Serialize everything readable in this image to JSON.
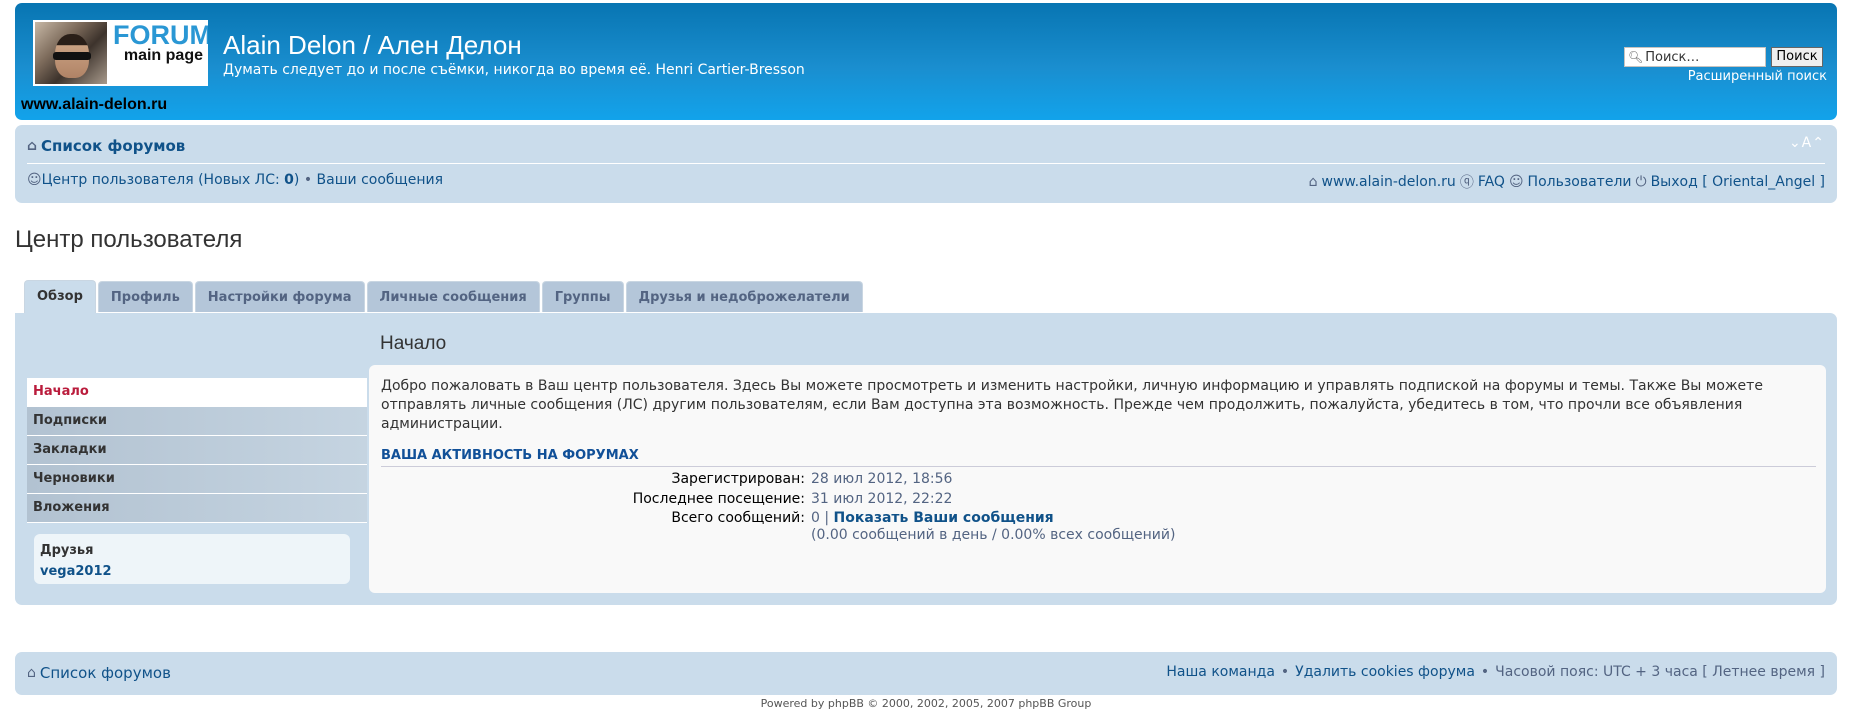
{
  "header": {
    "logo": {
      "line1": "FORUM",
      "line2": "main page"
    },
    "title": "Alain Delon / Ален Делон",
    "description": "Думать следует до и после съёмки, никогда во время её. Henri Cartier-Bresson",
    "site_url": "www.alain-delon.ru",
    "search": {
      "placeholder": "Поиск…",
      "button": "Поиск",
      "advanced": "Расширенный поиск"
    }
  },
  "navbar": {
    "forum_index": "Список форумов",
    "font_resize": "⌄A⌃",
    "ucp": {
      "label": "Центр пользователя (Новых ЛС: ",
      "count": "0",
      "close": ")",
      "sep": " • ",
      "your_posts": "Ваши сообщения"
    },
    "right": {
      "site": "www.alain-delon.ru",
      "faq": "FAQ",
      "members": "Пользователи",
      "logout": "Выход [ Oriental_Angel ]"
    }
  },
  "page_title": "Центр пользователя",
  "tabs": [
    {
      "label": "Обзор",
      "active": true
    },
    {
      "label": "Профиль"
    },
    {
      "label": "Настройки форума"
    },
    {
      "label": "Личные сообщения"
    },
    {
      "label": "Группы"
    },
    {
      "label": "Друзья и недоброжелатели"
    }
  ],
  "side_menu": [
    "Начало",
    "Подписки",
    "Закладки",
    "Черновики",
    "Вложения"
  ],
  "friends": {
    "title": "Друзья",
    "name": "vega2012"
  },
  "content": {
    "title": "Начало",
    "welcome": "Добро пожаловать в Ваш центр пользователя. Здесь Вы можете просмотреть и изменить настройки, личную информацию и управлять подпиской на форумы и темы. Также Вы можете отправлять личные сообщения (ЛС) другим пользователям, если Вам доступна эта возможность. Прежде чем продолжить, пожалуйста, убедитесь в том, что прочли все объявления администрации.",
    "activity_title": "ВАША АКТИВНОСТЬ НА ФОРУМАХ",
    "registered": {
      "label": "Зарегистрирован:",
      "value": "28 июл 2012, 18:56"
    },
    "last_visit": {
      "label": "Последнее посещение:",
      "value": "31 июл 2012, 22:22"
    },
    "total_posts": {
      "label": "Всего сообщений:",
      "value": "0 | ",
      "link": "Показать Ваши сообщения",
      "stats": "(0.00 сообщений в день / 0.00% всех сообщений)"
    }
  },
  "footer": {
    "forum_index": "Список форумов",
    "team": "Наша команда",
    "sep1": "•",
    "delete_cookies": "Удалить cookies форума",
    "sep2": "•",
    "timezone": "Часовой пояс: UTC + 3 часа [ Летнее время ]",
    "copyright": "Powered by phpBB © 2000, 2002, 2005, 2007 phpBB Group"
  },
  "colors": {
    "accent": "#105289",
    "panel": "#cadceb",
    "header_top": "#0875b2",
    "header_bottom": "#12a3eb",
    "active_menu": "#ba1c3c"
  }
}
